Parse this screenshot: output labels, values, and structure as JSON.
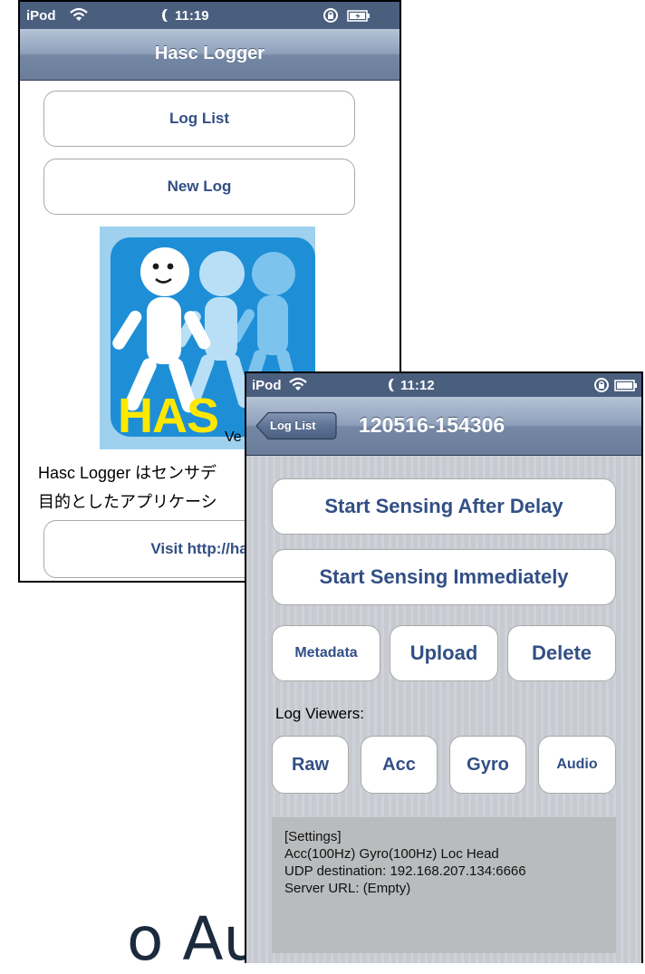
{
  "screen1": {
    "status": {
      "carrier": "iPod",
      "time": "11:19"
    },
    "nav_title": "Hasc Logger",
    "buttons": {
      "log_list": "Log List",
      "new_log": "New Log",
      "visit": "Visit http://ha"
    },
    "logo": {
      "text": "HAS",
      "version_fragment": "Ve"
    },
    "description": {
      "line1": "Hasc Logger はセンサデ",
      "line2": "目的としたアプリケーシ"
    }
  },
  "screen2": {
    "status": {
      "carrier": "iPod",
      "time": "11:12"
    },
    "nav": {
      "back_label": "Log List",
      "title": "120516-154306"
    },
    "buttons": {
      "start_delay": "Start Sensing After Delay",
      "start_now": "Start Sensing Immediately",
      "metadata": "Metadata",
      "upload": "Upload",
      "delete": "Delete"
    },
    "log_viewers_label": "Log Viewers:",
    "viewers": {
      "raw": "Raw",
      "acc": "Acc",
      "gyro": "Gyro",
      "audio": "Audio"
    },
    "settings": {
      "header": "[Settings]",
      "line1": "Acc(100Hz) Gyro(100Hz) Loc Head",
      "line2": "UDP destination: 192.168.207.134:6666",
      "line3": "Server URL: (Empty)"
    }
  },
  "caption": "o Audio",
  "colors": {
    "button_text": "#324f85",
    "status_bar": "#4a5e7e",
    "pinstripe_bg": "#c9ccd3",
    "settings_box": "#b9bbbd",
    "logo_blue": "#1e8fd6",
    "logo_yellow": "#ffe800"
  }
}
